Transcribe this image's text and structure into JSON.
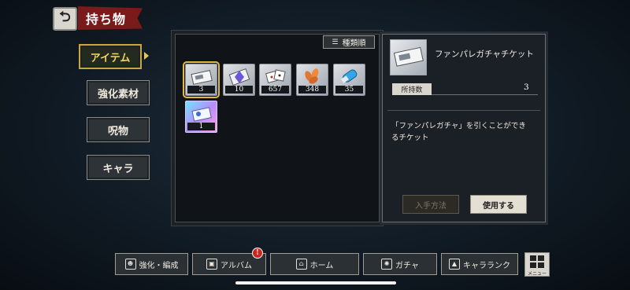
{
  "header": {
    "title": "持ち物",
    "back_icon": "back-arrow-icon"
  },
  "sidenav": {
    "items": [
      {
        "label": "アイテム",
        "active": true
      },
      {
        "label": "強化素材",
        "active": false
      },
      {
        "label": "呪物",
        "active": false
      },
      {
        "label": "キャラ",
        "active": false
      }
    ]
  },
  "list": {
    "sort_label": "種類順",
    "items": [
      {
        "count": "3",
        "icon": "gacha-ticket-icon",
        "selected": true
      },
      {
        "count": "10",
        "icon": "crystal-ticket-icon",
        "selected": false
      },
      {
        "count": "657",
        "icon": "dice-icon",
        "selected": false
      },
      {
        "count": "348",
        "icon": "leaf-icon",
        "selected": false
      },
      {
        "count": "35",
        "icon": "blue-capsule-icon",
        "selected": false
      },
      {
        "count": "1",
        "icon": "rainbow-ticket-icon",
        "selected": false
      }
    ]
  },
  "detail": {
    "name": "ファンパレガチャチケット",
    "owned_label": "所持数",
    "owned_value": "3",
    "description_line1": "「ファンパレガチャ」を引くことができ",
    "description_line2": "るチケット",
    "obtain_label": "入手方法",
    "use_label": "使用する"
  },
  "bottom_nav": {
    "items": [
      {
        "label": "強化・編成",
        "icon": "team-icon"
      },
      {
        "label": "アルバム",
        "icon": "album-icon"
      },
      {
        "label": "ホーム",
        "icon": "home-icon"
      },
      {
        "label": "ガチャ",
        "icon": "gacha-icon"
      },
      {
        "label": "キャラランク",
        "icon": "rank-icon"
      }
    ],
    "album_badge": "!",
    "menu_label": "メニュー"
  },
  "colors": {
    "accent_gold": "#e3b93b",
    "title_red": "#7a1a1a",
    "badge_red": "#c8261e"
  }
}
